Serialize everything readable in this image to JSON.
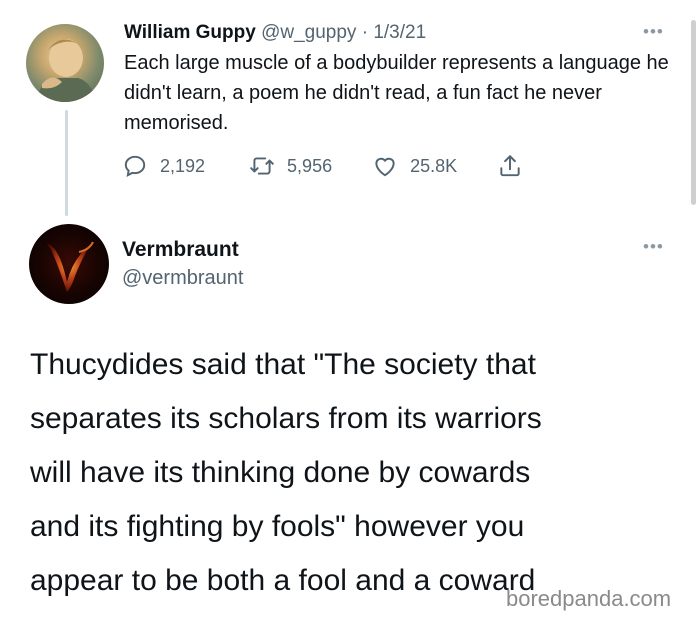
{
  "tweet1": {
    "display_name": "William Guppy",
    "handle": "@w_guppy",
    "separator": "·",
    "date": "1/3/21",
    "text": "Each large muscle of a bodybuilder represents a language he didn't learn, a poem he didn't read, a fun fact he never memorised.",
    "reply_count": "2,192",
    "retweet_count": "5,956",
    "like_count": "25.8K",
    "more_icon": "more-dots-icon"
  },
  "tweet2": {
    "display_name": "Vermbraunt",
    "handle": "@vermbraunt",
    "text_lines": [
      "Thucydides said that \"The society that",
      "separates its scholars from its warriors",
      "will have its thinking done by cowards",
      "and its fighting by fools\" however you",
      "appear to be both a fool and a coward"
    ],
    "avatar_letter": "V"
  },
  "watermark": "boredpanda.com",
  "colors": {
    "text": "#0f1419",
    "secondary": "#536471",
    "thread_line": "#cfd9de"
  }
}
